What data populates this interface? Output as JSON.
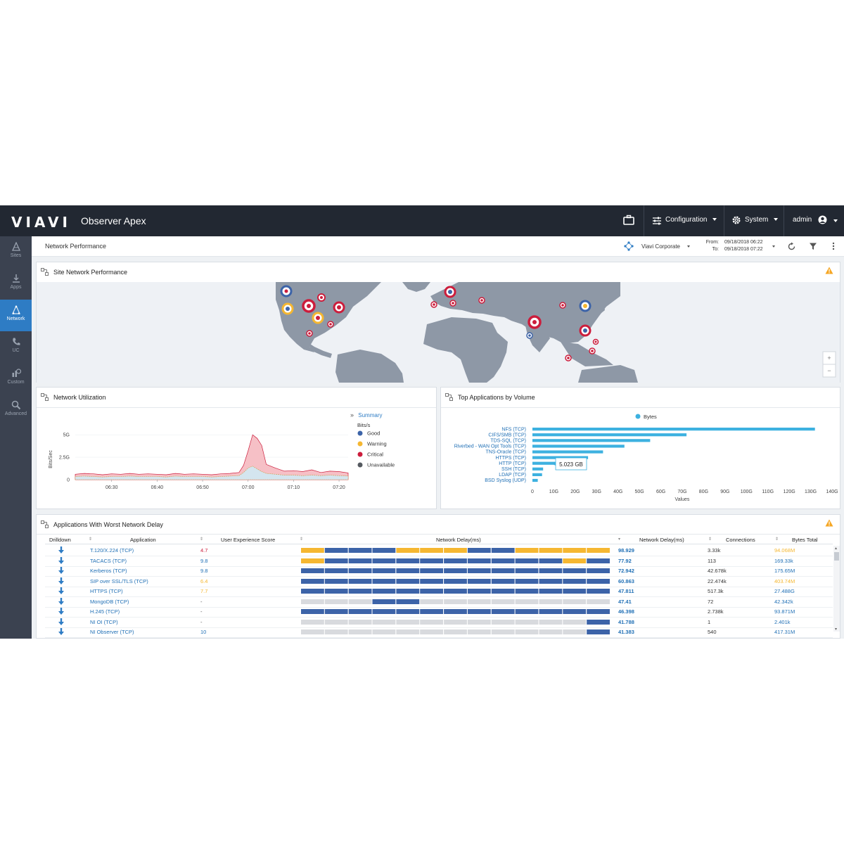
{
  "header": {
    "logo": "VIAVI",
    "product": "Observer Apex",
    "configuration_label": "Configuration",
    "system_label": "System",
    "user_label": "admin"
  },
  "sidebar": {
    "items": [
      {
        "label": "Sites",
        "icon": "sites-icon",
        "active": false
      },
      {
        "label": "Apps",
        "icon": "apps-icon",
        "active": false
      },
      {
        "label": "Network",
        "icon": "network-icon",
        "active": true
      },
      {
        "label": "UC",
        "icon": "phone-icon",
        "active": false
      },
      {
        "label": "Custom",
        "icon": "custom-chart-icon",
        "active": false
      },
      {
        "label": "Advanced",
        "icon": "search-icon",
        "active": false
      }
    ]
  },
  "subheader": {
    "breadcrumb": "Network Performance",
    "org": "Viavi Corporate",
    "from_label": "From:",
    "from_value": "09/18/2018 06:22",
    "to_label": "To:",
    "to_value": "09/18/2018 07:22"
  },
  "map_panel": {
    "title": "Site Network Performance",
    "zoom_in": "+",
    "zoom_out": "−"
  },
  "utilization_panel": {
    "title": "Network Utilization",
    "summary_label": "Summary",
    "units_label": "Bits/s",
    "legend": [
      {
        "label": "Good",
        "color": "#3c63a8"
      },
      {
        "label": "Warning",
        "color": "#f5b731"
      },
      {
        "label": "Critical",
        "color": "#cc1d3c"
      },
      {
        "label": "Unavailable",
        "color": "#555a60"
      }
    ],
    "chart_data": {
      "type": "area",
      "ylabel": "Bits/Sec",
      "yticks": [
        "5G",
        "2.5G",
        "0"
      ],
      "ylim": [
        0,
        6.5
      ],
      "xticks": [
        "06:30",
        "06:40",
        "06:50",
        "07:00",
        "07:10",
        "07:20"
      ],
      "x": [
        "06:22",
        "06:24",
        "06:26",
        "06:28",
        "06:30",
        "06:32",
        "06:34",
        "06:36",
        "06:38",
        "06:40",
        "06:42",
        "06:44",
        "06:46",
        "06:48",
        "06:50",
        "06:52",
        "06:54",
        "06:56",
        "06:58",
        "06:59",
        "07:00",
        "07:01",
        "07:02",
        "07:03",
        "07:04",
        "07:06",
        "07:08",
        "07:10",
        "07:12",
        "07:14",
        "07:16",
        "07:18",
        "07:20",
        "07:22"
      ],
      "series": [
        {
          "name": "Critical",
          "values": [
            0.6,
            0.7,
            0.65,
            0.55,
            0.65,
            0.6,
            0.7,
            0.6,
            0.65,
            0.6,
            0.55,
            0.7,
            0.6,
            0.65,
            0.6,
            0.55,
            0.65,
            0.7,
            0.8,
            1.6,
            3.2,
            5.0,
            4.6,
            3.8,
            1.7,
            1.3,
            0.95,
            1.0,
            0.9,
            1.1,
            0.8,
            0.95,
            0.9,
            0.75
          ]
        },
        {
          "name": "Unavailable",
          "values": [
            0.35,
            0.4,
            0.35,
            0.3,
            0.35,
            0.35,
            0.4,
            0.35,
            0.35,
            0.35,
            0.3,
            0.4,
            0.35,
            0.35,
            0.35,
            0.3,
            0.35,
            0.4,
            0.45,
            0.8,
            1.3,
            1.5,
            1.2,
            0.9,
            0.7,
            0.6,
            0.5,
            0.5,
            0.45,
            0.5,
            0.45,
            0.5,
            0.45,
            0.4
          ]
        }
      ]
    }
  },
  "top_apps_panel": {
    "title": "Top Applications by Volume",
    "tooltip": "5.023 GB",
    "chart_data": {
      "type": "bar",
      "orientation": "horizontal",
      "legend": [
        "Bytes"
      ],
      "categories": [
        "NFS (TCP)",
        "CIFS/SMB (TCP)",
        "TDS-SQL (TCP)",
        "Riverbed - WAN Opt Tools (TCP)",
        "TNS-Oracle (TCP)",
        "HTTPS (TCP)",
        "HTTP (TCP)",
        "SSH (TCP)",
        "LDAP (TCP)",
        "BSD Syslog (UDP)"
      ],
      "series": [
        {
          "name": "Bytes",
          "values": [
            132,
            72,
            55,
            43,
            33,
            26,
            11,
            5,
            4.5,
            2.5
          ]
        }
      ],
      "xticks": [
        "0",
        "10G",
        "20G",
        "30G",
        "40G",
        "50G",
        "60G",
        "70G",
        "80G",
        "90G",
        "100G",
        "110G",
        "120G",
        "130G",
        "140G"
      ],
      "xlabel": "Values",
      "xlim": [
        0,
        140
      ],
      "color": "#3db1e0"
    }
  },
  "delay_panel": {
    "title": "Applications With Worst Network Delay",
    "columns": [
      "Drilldown",
      "Application",
      "User Experience Score",
      "Network Delay(ms)",
      "Network Delay(ms)",
      "Connections",
      "Bytes Total"
    ],
    "rows": [
      {
        "app": "T.120/X.224 (TCP)",
        "score": "4.7",
        "score_status": "critical",
        "segments": "wbbbwwwbbwwww",
        "delay": "98.929",
        "connections": "3.33k",
        "bytes": "94.068M",
        "bytes_status": "warning"
      },
      {
        "app": "TACACS (TCP)",
        "score": "9.8",
        "score_status": "good",
        "segments": "wbbbbbbbbbbwb",
        "delay": "77.92",
        "connections": "113",
        "bytes": "169.33k",
        "bytes_status": "good"
      },
      {
        "app": "Kerberos (TCP)",
        "score": "9.8",
        "score_status": "good",
        "segments": "bbbbbbbbbbbbb",
        "delay": "72.942",
        "connections": "42.678k",
        "bytes": "175.65M",
        "bytes_status": "good"
      },
      {
        "app": "SIP over SSL/TLS (TCP)",
        "score": "6.4",
        "score_status": "warning",
        "segments": "bbbbbbbbbbbbb",
        "delay": "60.863",
        "connections": "22.474k",
        "bytes": "403.74M",
        "bytes_status": "warning"
      },
      {
        "app": "HTTPS (TCP)",
        "score": "7.7",
        "score_status": "warning",
        "segments": "bbbbbbbbbbbbb",
        "delay": "47.811",
        "connections": "517.3k",
        "bytes": "27.488G",
        "bytes_status": "good"
      },
      {
        "app": "MongoDB (TCP)",
        "score": "-",
        "score_status": "none",
        "segments": "gggbbgggggggg",
        "delay": "47.41",
        "connections": "72",
        "bytes": "42.342k",
        "bytes_status": "good"
      },
      {
        "app": "H.245 (TCP)",
        "score": "-",
        "score_status": "none",
        "segments": "bbbbbbbbbbbbb",
        "delay": "46.398",
        "connections": "2.738k",
        "bytes": "93.871M",
        "bytes_status": "good"
      },
      {
        "app": "NI OI (TCP)",
        "score": "-",
        "score_status": "none",
        "segments": "ggggggggggggb",
        "delay": "41.788",
        "connections": "1",
        "bytes": "2.401k",
        "bytes_status": "good"
      },
      {
        "app": "NI Observer (TCP)",
        "score": "10",
        "score_status": "good",
        "segments": "ggggggggggggb",
        "delay": "41.383",
        "connections": "540",
        "bytes": "417.31M",
        "bytes_status": "good"
      }
    ]
  },
  "colors": {
    "good": "#3c63a8",
    "warning": "#f5b731",
    "critical": "#cc1d3c",
    "neutral": "#d8dade",
    "link": "#1f6fb5",
    "accent": "#2e7cc4"
  }
}
